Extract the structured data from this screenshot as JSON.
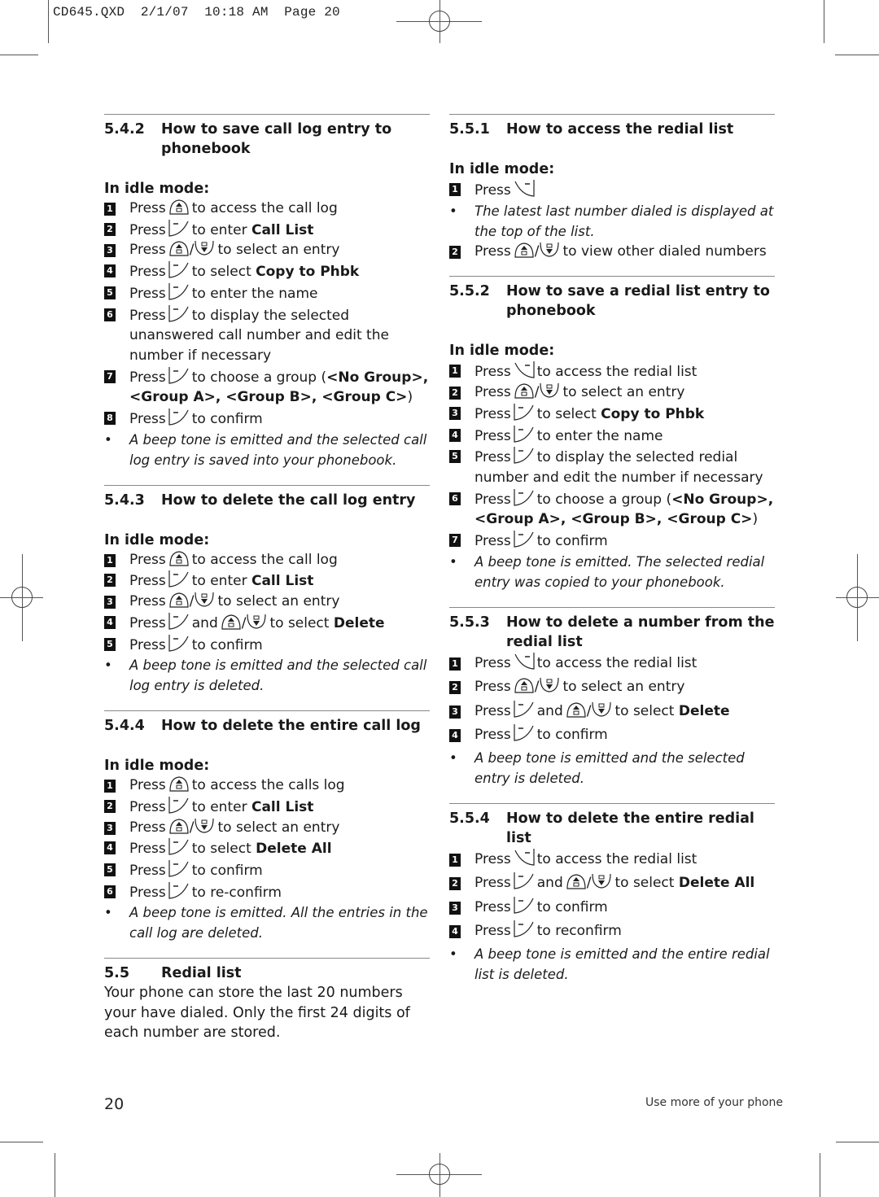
{
  "slug": "CD645.QXD  2/1/07  10:18 AM  Page 20",
  "footer": {
    "page_number": "20",
    "running_title": "Use more of your phone"
  },
  "left_column": {
    "s542": {
      "number": "5.4.2",
      "title": "How to save call log entry to phonebook",
      "mode": "In idle mode:",
      "steps": [
        {
          "n": "1",
          "pre": "Press",
          "key": "up",
          "mid": "to access the call log",
          "bold": "",
          "post": ""
        },
        {
          "n": "2",
          "pre": "Press",
          "key": "soft",
          "mid": "to enter ",
          "bold": "Call List",
          "post": ""
        },
        {
          "n": "3",
          "pre": "Press",
          "key": "updown",
          "mid": "to select an entry",
          "bold": "",
          "post": ""
        },
        {
          "n": "4",
          "pre": "Press",
          "key": "soft",
          "mid": "to select ",
          "bold": "Copy to Phbk",
          "post": ""
        },
        {
          "n": "5",
          "pre": "Press",
          "key": "soft",
          "mid": "to enter the name",
          "bold": "",
          "post": ""
        },
        {
          "n": "6",
          "pre": "Press",
          "key": "soft",
          "mid": "to display the selected unanswered call number and edit the number if necessary",
          "bold": "",
          "post": ""
        },
        {
          "n": "7",
          "pre": "Press",
          "key": "soft",
          "mid": "to choose a group (",
          "bold": "<No Group>, <Group A>, <Group B>, <Group C>",
          "post": ")"
        },
        {
          "n": "8",
          "pre": "Press",
          "key": "soft",
          "mid": "to confirm",
          "bold": "",
          "post": ""
        }
      ],
      "note": "A beep tone is emitted and the selected call log entry is saved into your phonebook."
    },
    "s543": {
      "number": "5.4.3",
      "title": "How to delete the call log entry",
      "mode": "In idle mode:",
      "steps": [
        {
          "n": "1",
          "pre": "Press",
          "key": "up",
          "mid": "to access the call log",
          "bold": "",
          "post": ""
        },
        {
          "n": "2",
          "pre": "Press",
          "key": "soft",
          "mid": "to enter ",
          "bold": "Call List",
          "post": ""
        },
        {
          "n": "3",
          "pre": "Press",
          "key": "updown",
          "mid": "to select an entry",
          "bold": "",
          "post": ""
        },
        {
          "n": "4",
          "pre": "Press",
          "key": "soft-and-updown",
          "mid": "to select ",
          "bold": "Delete",
          "post": ""
        },
        {
          "n": "5",
          "pre": "Press",
          "key": "soft",
          "mid": "to confirm",
          "bold": "",
          "post": ""
        }
      ],
      "note": "A beep tone is emitted and the selected call log entry is deleted."
    },
    "s544": {
      "number": "5.4.4",
      "title": "How to delete the entire call log",
      "mode": "In idle mode:",
      "steps": [
        {
          "n": "1",
          "pre": "Press",
          "key": "up",
          "mid": "to access the calls log",
          "bold": "",
          "post": ""
        },
        {
          "n": "2",
          "pre": "Press",
          "key": "soft",
          "mid": "to enter ",
          "bold": "Call List",
          "post": ""
        },
        {
          "n": "3",
          "pre": "Press",
          "key": "updown",
          "mid": "to select an entry",
          "bold": "",
          "post": ""
        },
        {
          "n": "4",
          "pre": "Press",
          "key": "soft",
          "mid": "to select ",
          "bold": "Delete All",
          "post": ""
        },
        {
          "n": "5",
          "pre": "Press",
          "key": "soft",
          "mid": "to confirm",
          "bold": "",
          "post": ""
        },
        {
          "n": "6",
          "pre": "Press",
          "key": "soft",
          "mid": "to re-confirm",
          "bold": "",
          "post": ""
        }
      ],
      "note": "A beep tone is emitted. All the entries in the call log are deleted."
    },
    "s55": {
      "number": "5.5",
      "title": "Redial list",
      "body": "Your phone can store the last 20 numbers your have dialed. Only the first 24 digits of each number are stored."
    }
  },
  "right_column": {
    "s551": {
      "number": "5.5.1",
      "title": "How to access the redial list",
      "mode": "In idle mode:",
      "step1": {
        "n": "1",
        "pre": "Press",
        "key": "redial"
      },
      "note": "The latest last number dialed is displayed at the top of the list.",
      "step2": {
        "n": "2",
        "pre": "Press",
        "key": "updown",
        "mid": "to view other dialed numbers"
      }
    },
    "s552": {
      "number": "5.5.2",
      "title": "How to save a redial list entry to phonebook",
      "mode": "In idle mode:",
      "steps": [
        {
          "n": "1",
          "pre": "Press",
          "key": "redial",
          "mid": "to access the redial list",
          "bold": "",
          "post": ""
        },
        {
          "n": "2",
          "pre": "Press",
          "key": "updown",
          "mid": "to select an entry",
          "bold": "",
          "post": ""
        },
        {
          "n": "3",
          "pre": "Press",
          "key": "soft",
          "mid": "to select ",
          "bold": "Copy to Phbk",
          "post": ""
        },
        {
          "n": "4",
          "pre": "Press",
          "key": "soft",
          "mid": "to enter the name",
          "bold": "",
          "post": ""
        },
        {
          "n": "5",
          "pre": "Press",
          "key": "soft",
          "mid": "to display the selected redial number and edit the number if necessary",
          "bold": "",
          "post": ""
        },
        {
          "n": "6",
          "pre": "Press",
          "key": "soft",
          "mid": "to choose a group (",
          "bold": "<No Group>, <Group A>, <Group B>, <Group C>",
          "post": ")"
        },
        {
          "n": "7",
          "pre": "Press",
          "key": "soft",
          "mid": "to confirm",
          "bold": "",
          "post": ""
        }
      ],
      "note": "A beep tone is emitted. The selected redial entry was copied to your phonebook."
    },
    "s553": {
      "number": "5.5.3",
      "title": "How to delete a number from the redial list",
      "steps": [
        {
          "n": "1",
          "pre": "Press",
          "key": "redial",
          "mid": "to access the redial list",
          "bold": "",
          "post": ""
        },
        {
          "n": "2",
          "pre": "Press",
          "key": "updown",
          "mid": "to select an entry",
          "bold": "",
          "post": ""
        },
        {
          "n": "3",
          "pre": "Press",
          "key": "soft-and-updown",
          "mid": "to select ",
          "bold": "Delete",
          "post": ""
        },
        {
          "n": "4",
          "pre": "Press",
          "key": "soft",
          "mid": "to confirm",
          "bold": "",
          "post": ""
        }
      ],
      "note": "A beep tone is emitted and the selected entry is deleted."
    },
    "s554": {
      "number": "5.5.4",
      "title": "How to delete the entire redial list",
      "steps": [
        {
          "n": "1",
          "pre": "Press",
          "key": "redial",
          "mid": "to access the redial list",
          "bold": "",
          "post": ""
        },
        {
          "n": "2",
          "pre": "Press",
          "key": "soft-and-updown",
          "mid": "to select ",
          "bold": "Delete All",
          "post": ""
        },
        {
          "n": "3",
          "pre": "Press",
          "key": "soft",
          "mid": "to confirm",
          "bold": "",
          "post": ""
        },
        {
          "n": "4",
          "pre": "Press",
          "key": "soft",
          "mid": "to reconfirm",
          "bold": "",
          "post": ""
        }
      ],
      "note": "A beep tone is emitted and the entire redial list is deleted."
    }
  },
  "labels": {
    "and": "and"
  },
  "icons": {
    "up": "up-calllog-key-icon",
    "down": "down-phonebook-key-icon",
    "soft": "right-softkey-icon",
    "redial": "left-softkey-redial-icon"
  }
}
